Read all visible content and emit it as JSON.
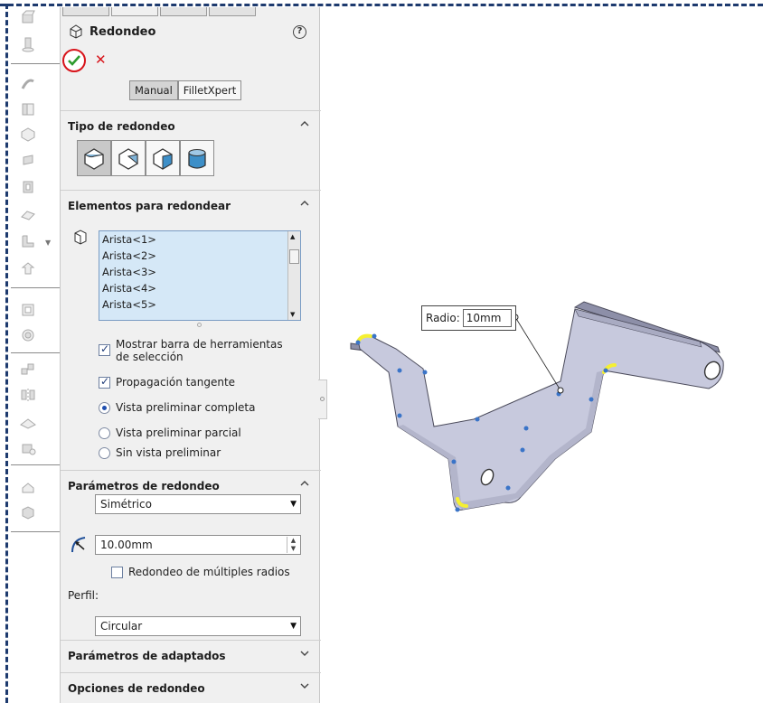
{
  "feature": {
    "title": "Redondeo",
    "mode_buttons": [
      "Manual",
      "FilletXpert"
    ],
    "active_mode": "Manual"
  },
  "sections": {
    "fillet_type": {
      "title": "Tipo de redondeo"
    },
    "items_to_fillet": {
      "title": "Elementos para redondear",
      "edges": [
        "Arista<1>",
        "Arista<2>",
        "Arista<3>",
        "Arista<4>",
        "Arista<5>"
      ],
      "show_toolbar_label_1": "Mostrar barra de herramientas",
      "show_toolbar_label_2": "de selección",
      "show_toolbar_checked": true,
      "tangent_propagation_label": "Propagación tangente",
      "tangent_propagation_checked": true,
      "preview_options": [
        "Vista preliminar completa",
        "Vista preliminar parcial",
        "Sin vista preliminar"
      ],
      "preview_selected": "Vista preliminar completa"
    },
    "fillet_parameters": {
      "title": "Parámetros de redondeo",
      "method": "Simétrico",
      "radius_value": "10.00mm",
      "multi_radius_label": "Redondeo de múltiples radios",
      "multi_radius_checked": false,
      "profile_label": "Perfil:",
      "profile": "Circular"
    },
    "setback": {
      "title": "Parámetros de adaptados"
    },
    "fillet_options": {
      "title": "Opciones de redondeo"
    }
  },
  "callout": {
    "label": "Radio:",
    "value": "10mm"
  },
  "colors": {
    "accent_red": "#d8141b",
    "ok_green": "#2e9b2e",
    "list_bg": "#d5e8f7",
    "part_face": "#c7c9dd",
    "edge_highlight": "#f5f032",
    "frame": "#1d3a6e"
  }
}
